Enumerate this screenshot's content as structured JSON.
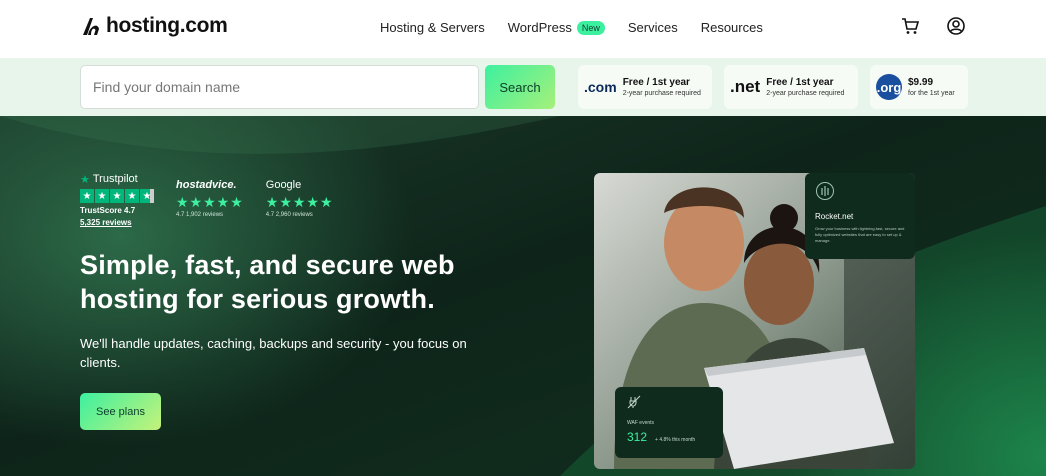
{
  "nav": {
    "logo_text": "hosting.com",
    "menu": [
      "Hosting & Servers",
      "WordPress",
      "Services",
      "Resources"
    ],
    "new_badge": "New",
    "icons": [
      "cart-icon",
      "account-icon"
    ]
  },
  "domain_search": {
    "placeholder": "Find your domain name",
    "button": "Search",
    "tlds": [
      {
        "name": ".com",
        "price": "Free / 1st year",
        "note": "2-year purchase required"
      },
      {
        "name": ".net",
        "price": "Free / 1st year",
        "note": "2-year purchase required"
      },
      {
        "name": ".org",
        "price": "$9.99",
        "note": "for the 1st year"
      }
    ]
  },
  "reviews": {
    "trustpilot": {
      "brand": "Trustpilot",
      "score": "TrustScore 4.7",
      "count": "5,325 reviews"
    },
    "hostadvice": {
      "brand": "hostadvice.",
      "meta": "4.7 1,902 reviews"
    },
    "google": {
      "brand": "Google",
      "meta": "4.7 2,960 reviews"
    }
  },
  "hero": {
    "headline_a": "Simple, fast, and secure ",
    "headline_b": "web hosting",
    "headline_c": " for serious growth.",
    "subheading": "We'll handle updates, caching, backups and security - you focus on clients.",
    "cta": "See plans"
  },
  "cards": {
    "rocket": {
      "title": "Rocket.net",
      "desc": "Grow your business with lightning-fast, secure and fully optimized websites that are easy to set up & manage."
    },
    "waf": {
      "label": "WAF events",
      "value": "312",
      "delta": "+ 4.8% this month"
    }
  },
  "colors": {
    "accent": "#3df0a0",
    "dark_green": "#0f2b1e",
    "domain_bar": "#e8f5ea"
  }
}
